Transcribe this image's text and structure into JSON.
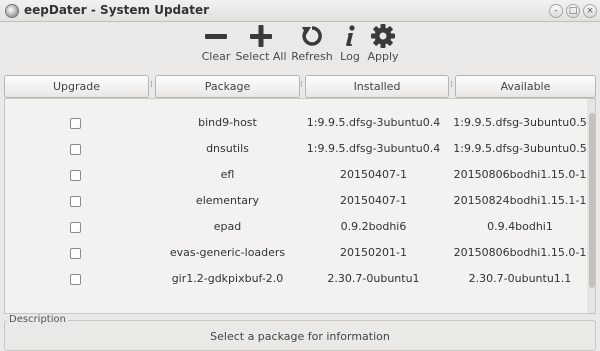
{
  "window": {
    "title": "eepDater - System Updater",
    "controls": [
      "-",
      "□",
      "×"
    ]
  },
  "toolbar": {
    "clear_label": "Clear",
    "select_all_label": "Select All",
    "refresh_label": "Refresh",
    "log_label": "Log",
    "apply_label": "Apply"
  },
  "columns": {
    "upgrade": "Upgrade",
    "package": "Package",
    "installed": "Installed",
    "available": "Available"
  },
  "packages": [
    {
      "name": "bind9-host",
      "installed": "1:9.9.5.dfsg-3ubuntu0.4",
      "available": "1:9.9.5.dfsg-3ubuntu0.5"
    },
    {
      "name": "dnsutils",
      "installed": "1:9.9.5.dfsg-3ubuntu0.4",
      "available": "1:9.9.5.dfsg-3ubuntu0.5"
    },
    {
      "name": "efl",
      "installed": "20150407-1",
      "available": "20150806bodhi1.15.0-1"
    },
    {
      "name": "elementary",
      "installed": "20150407-1",
      "available": "20150824bodhi1.15.1-1"
    },
    {
      "name": "epad",
      "installed": "0.9.2bodhi6",
      "available": "0.9.4bodhi1"
    },
    {
      "name": "evas-generic-loaders",
      "installed": "20150201-1",
      "available": "20150806bodhi1.15.0-1"
    },
    {
      "name": "gir1.2-gdkpixbuf-2.0",
      "installed": "2.30.7-0ubuntu1",
      "available": "2.30.7-0ubuntu1.1"
    }
  ],
  "description": {
    "label": "Description",
    "text": "Select a package for information"
  },
  "colors": {
    "background": "#ebe9e7",
    "list_background": "#f3f2f1",
    "icon": "#3a3a3a"
  }
}
